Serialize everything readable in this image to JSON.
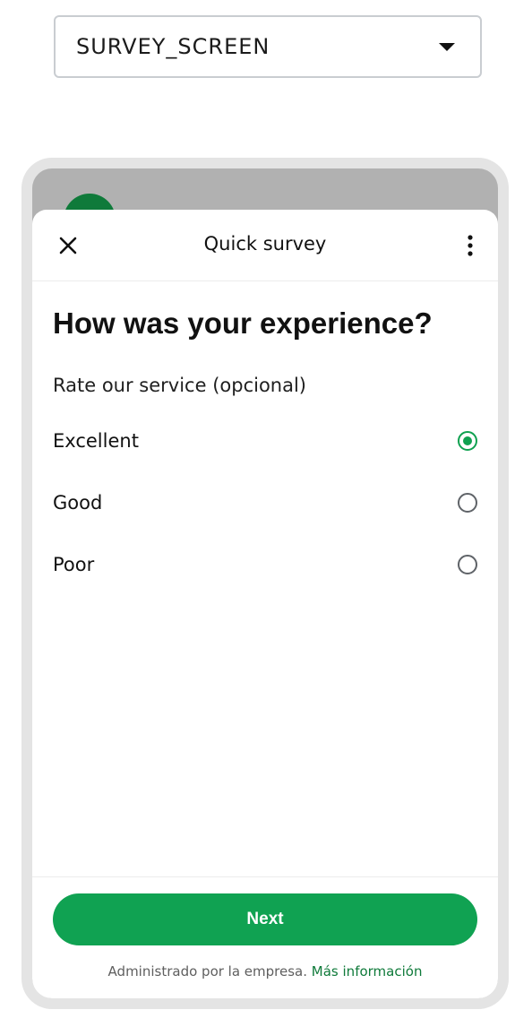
{
  "screen_selector": {
    "value": "SURVEY_SCREEN"
  },
  "header": {
    "title": "Quick survey",
    "close_icon": "close-icon",
    "menu_icon": "more-vertical-icon"
  },
  "question": "How was your experience?",
  "subtitle": "Rate our service (opcional)",
  "options": [
    {
      "label": "Excellent",
      "selected": true
    },
    {
      "label": "Good",
      "selected": false
    },
    {
      "label": "Poor",
      "selected": false
    }
  ],
  "next_button": {
    "label": "Next"
  },
  "footer": {
    "text": "Administrado por la empresa.",
    "link": "Más información"
  },
  "colors": {
    "accent": "#10a252",
    "link": "#0f7a3a",
    "avatar": "#0f7a3a"
  }
}
